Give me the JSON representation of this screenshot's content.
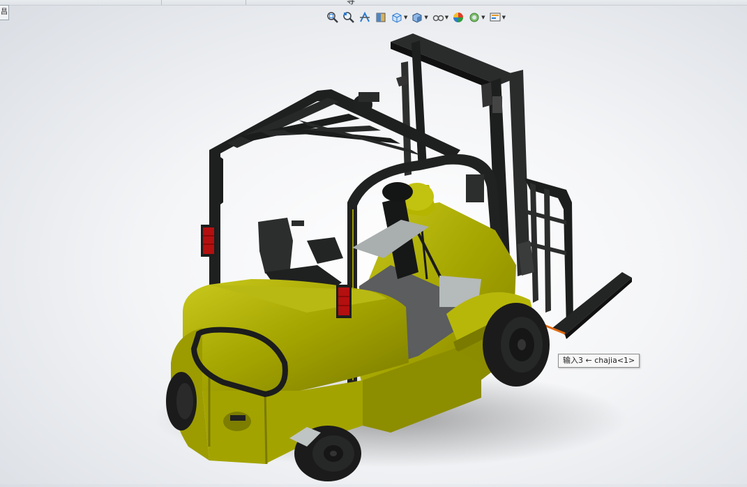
{
  "window": {
    "top_glyph": "导",
    "corner_tab_label": "昌"
  },
  "toolbar": {
    "tools": [
      {
        "icon": "zoom-to-fit-icon"
      },
      {
        "icon": "zoom-to-area-icon"
      },
      {
        "icon": "previous-view-icon"
      },
      {
        "icon": "section-view-icon"
      },
      {
        "icon": "view-orientation-icon"
      },
      {
        "icon": "display-style-icon"
      },
      {
        "icon": "hide-show-items-icon"
      },
      {
        "icon": "edit-appearance-icon"
      },
      {
        "icon": "apply-scene-icon"
      },
      {
        "icon": "view-settings-icon"
      }
    ]
  },
  "model": {
    "name": "forklift",
    "colors": {
      "body": "#a8a800",
      "body_light": "#c8c81c",
      "body_dark": "#6e6e00",
      "frame": "#1e1f1f",
      "tyre": "#1b1b1b",
      "hub": "#bfc4c4",
      "lamp": "#b3100f"
    }
  },
  "tooltip": {
    "text": "输入3 ← chajia<1>"
  }
}
